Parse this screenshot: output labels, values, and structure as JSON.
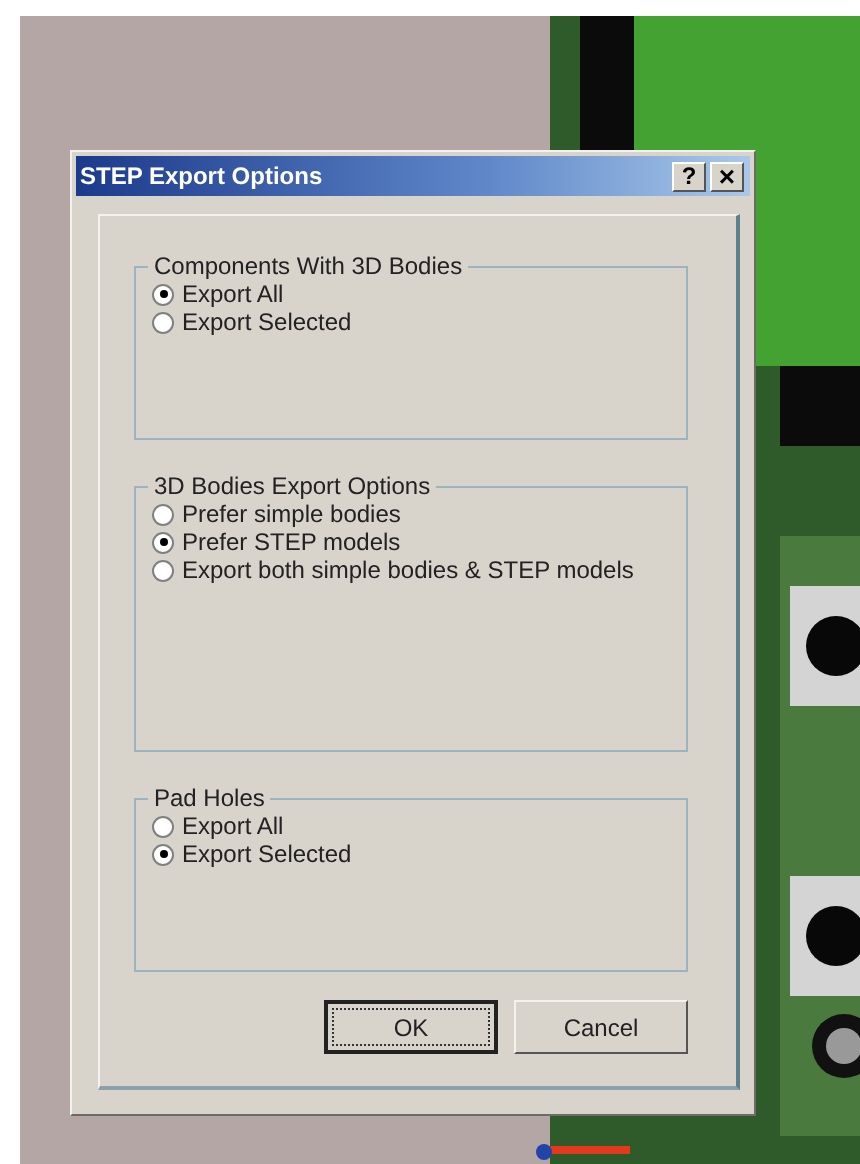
{
  "window": {
    "title": "STEP Export Options",
    "title_buttons": [
      {
        "kind": "help",
        "label": "?"
      },
      {
        "kind": "close",
        "label": "×"
      }
    ]
  },
  "groups": [
    {
      "title": "Components With 3D Bodies",
      "options": [
        {
          "label": "Export All",
          "selected": true
        },
        {
          "label": "Export Selected",
          "selected": false
        }
      ]
    },
    {
      "title": "3D Bodies Export Options",
      "options": [
        {
          "label": "Prefer simple bodies",
          "selected": false
        },
        {
          "label": "Prefer STEP models",
          "selected": true
        },
        {
          "label": "Export both simple bodies & STEP models",
          "selected": false
        }
      ]
    },
    {
      "title": "Pad Holes",
      "options": [
        {
          "label": "Export All",
          "selected": false
        },
        {
          "label": "Export Selected",
          "selected": true
        }
      ]
    }
  ],
  "buttons": [
    {
      "label": "OK",
      "default": true
    },
    {
      "label": "Cancel",
      "default": false
    }
  ]
}
